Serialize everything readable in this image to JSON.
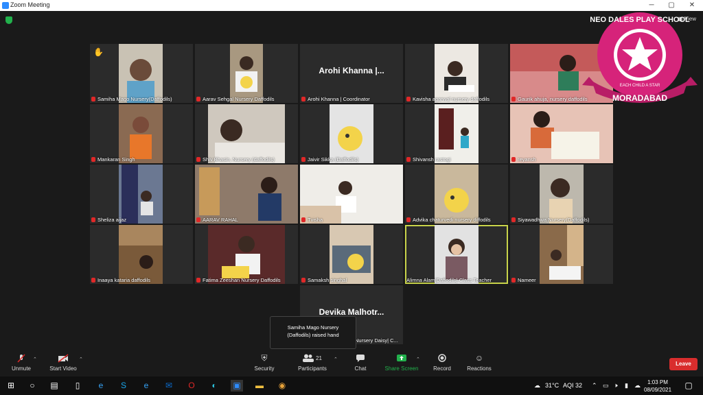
{
  "window": {
    "title": "Zoom Meeting",
    "minimize": "─",
    "maximize": "▢",
    "close": "✕"
  },
  "top": {
    "view_label": "View",
    "security_icon": "shield-check-icon"
  },
  "logo": {
    "text_top": "NEO DALES PLAY SCHOOL",
    "tagline": "EACH CHILD A STAR",
    "city": "MORADABAD",
    "colors": {
      "main": "#d6237a",
      "ring": "#ffffff"
    }
  },
  "participants": [
    {
      "name": "Samiha Mago Nursery(Daffodils)",
      "video": true,
      "muted": true,
      "hand": true
    },
    {
      "name": "Aarav Sehgal Nursery Daffodils",
      "video": true,
      "muted": true
    },
    {
      "name": "Arohi Khanna | Coordinator",
      "display": "Arohi Khanna |...",
      "video": false,
      "muted": true
    },
    {
      "name": "Kavisha agarwal nursery daffodils",
      "video": true,
      "muted": true
    },
    {
      "name": "Gaurik ahuja, nursery daffodils",
      "video": true,
      "muted": true
    },
    {
      "name": "Mankaran Singh",
      "video": true,
      "muted": true
    },
    {
      "name": "Shiv Bhasin, Nursery (daffodils)",
      "video": true,
      "muted": true
    },
    {
      "name": "Jaivir Sikka (Daffodils)",
      "video": true,
      "muted": true
    },
    {
      "name": "Shivansh rastogi",
      "video": true,
      "muted": true
    },
    {
      "name": "reyansh",
      "video": true,
      "muted": true
    },
    {
      "name": "Sheliza aijaz",
      "video": true,
      "muted": true
    },
    {
      "name": "AARAV RAHAL",
      "video": true,
      "muted": true
    },
    {
      "name": "Tvisha",
      "video": true,
      "muted": true
    },
    {
      "name": "Advika chaturvedi nursery diffodils",
      "video": true,
      "muted": true
    },
    {
      "name": "Siyawadhwa Nursery(Daffodils)",
      "video": true,
      "muted": true
    },
    {
      "name": "Inaaya kataria daffodils",
      "video": true,
      "muted": true
    },
    {
      "name": "Fatima Zeeshan Nursery Daffodils",
      "video": true,
      "muted": true
    },
    {
      "name": "Samaksh singhal",
      "video": true,
      "muted": true
    },
    {
      "name": "Alimna Alam|Daffodils| Class Teacher",
      "video": true,
      "muted": false,
      "active": true
    },
    {
      "name": "Nameer",
      "video": true,
      "muted": true
    },
    {
      "name": "Nursery Daisy| C...",
      "display": "Devika  Malhotr...",
      "video": false,
      "muted": true
    }
  ],
  "tooltip": {
    "line1": "Samiha Mago Nursery",
    "line2": "(Daffodils) raised hand"
  },
  "toolbar": {
    "unmute": "Unmute",
    "start_video": "Start Video",
    "security": "Security",
    "participants": "Participants",
    "participants_count": "21",
    "chat": "Chat",
    "share_screen": "Share Screen",
    "record": "Record",
    "reactions": "Reactions",
    "leave": "Leave",
    "share_color": "#22b14c"
  },
  "taskbar": {
    "weather": "31°C",
    "aqi": "AQI 32",
    "time": "1:03 PM",
    "date": "08/09/2021"
  }
}
